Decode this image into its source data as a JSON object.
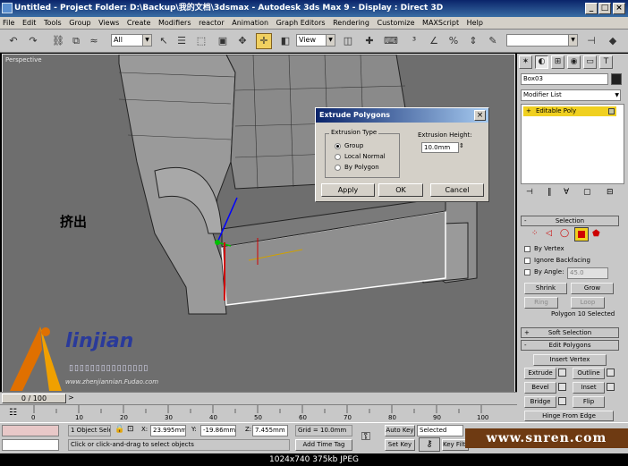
{
  "window": {
    "title": "Untitled    - Project Folder: D:\\Backup\\我的文档\\3dsmax    - Autodesk 3ds Max 9         - Display : Direct 3D"
  },
  "menu": [
    "File",
    "Edit",
    "Tools",
    "Group",
    "Views",
    "Create",
    "Modifiers",
    "reactor",
    "Animation",
    "Graph Editors",
    "Rendering",
    "Customize",
    "MAXScript",
    "Help"
  ],
  "toolbar": {
    "selection_filter": "All",
    "reference_coord": "View"
  },
  "viewport": {
    "label": "Perspective",
    "annotation": "挤出",
    "logo_text": "linjian",
    "logo_url": "www.zhenjiannian.Fudao.com"
  },
  "dialog": {
    "title": "Extrude Polygons",
    "group_title": "Extrusion Type",
    "options": [
      "Group",
      "Local Normal",
      "By Polygon"
    ],
    "selected_option": "Group",
    "height_label": "Extrusion Height:",
    "height_value": "10.0mm",
    "apply": "Apply",
    "ok": "OK",
    "cancel": "Cancel"
  },
  "command_panel": {
    "object_name": "Box03",
    "modifier_list": "Modifier List",
    "stack_item": "Editable Poly",
    "selection_rollout": "Selection",
    "by_vertex": "By Vertex",
    "ignore_backfacing": "Ignore Backfacing",
    "by_angle": "By Angle:",
    "angle_value": "45.0",
    "shrink": "Shrink",
    "grow": "Grow",
    "ring": "Ring",
    "loop": "Loop",
    "selection_info": "Polygon 10 Selected",
    "soft_selection": "Soft Selection",
    "edit_polygons": "Edit Polygons",
    "insert_vertex": "Insert Vertex",
    "extrude": "Extrude",
    "outline": "Outline",
    "bevel": "Bevel",
    "inset": "Inset",
    "bridge": "Bridge",
    "flip": "Flip",
    "hinge": "Hinge From Edge"
  },
  "timeline": {
    "frame_label": "0 / 100",
    "ticks": [
      "0",
      "10",
      "20",
      "30",
      "40",
      "50",
      "60",
      "70",
      "80",
      "90",
      "100"
    ]
  },
  "status": {
    "selection": "1 Object Sele",
    "prompt": "Click or click-and-drag to select objects",
    "x_label": "X:",
    "x": "23.995mm",
    "y_label": "Y:",
    "y": "-19.86mm",
    "z_label": "Z:",
    "z": "7.455mm",
    "grid": "Grid = 10.0mm",
    "add_time_tag": "Add Time Tag",
    "auto_key": "Auto Key",
    "selected": "Selected",
    "set_key": "Set Key",
    "key_filters": "Key Filte"
  },
  "watermark": "www.snren.com",
  "caption": "1024x740  375kb  JPEG",
  "colors": {
    "title_bar": "#0a246a",
    "viewport_bg": "#6e6e6e",
    "active_tool": "#f0d060",
    "selected_poly": "#f0c020"
  }
}
